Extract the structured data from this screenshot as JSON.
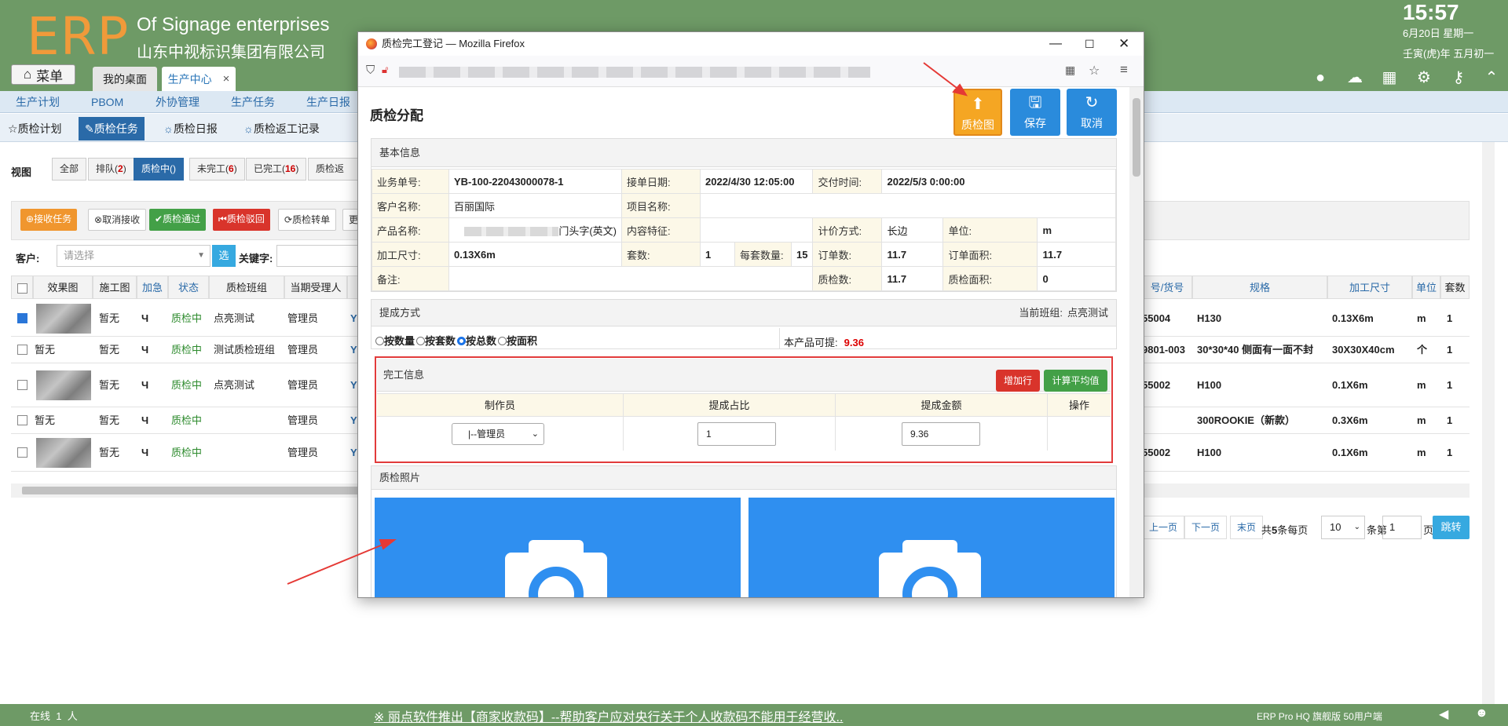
{
  "header": {
    "logo": "ERP",
    "company_en": "Of Signage enterprises",
    "company_cn": "山东中视标识集团有限公司",
    "time": "15:57",
    "date": "6月20日 星期一",
    "lunar": "壬寅(虎)年 五月初一",
    "menu_label": "菜单",
    "tabs": [
      {
        "label": "我的桌面"
      },
      {
        "label": "生产中心"
      }
    ],
    "tab_close": "×"
  },
  "nav1": [
    "生产计划",
    "PBOM",
    "外协管理",
    "生产任务",
    "生产日报"
  ],
  "nav2": [
    "质检计划",
    "质检任务",
    "质检日报",
    "质检返工记录"
  ],
  "view": {
    "label": "视图",
    "filters": [
      {
        "label": "全部",
        "count": ""
      },
      {
        "label": "排队(",
        "count": "2",
        "close": ")"
      },
      {
        "label": "质检中(",
        "count": "",
        "close": ")"
      },
      {
        "label": "未完工(",
        "count": "6",
        "close": ")"
      },
      {
        "label": "已完工(",
        "count": "16",
        "close": ")"
      },
      {
        "label": "质检返工(",
        "count": "",
        "close": ""
      }
    ]
  },
  "toolbar": {
    "buttons": [
      "接收任务",
      "取消接收",
      "质检通过",
      "质检驳回",
      "质检转单",
      "更"
    ],
    "customer_label": "客户:",
    "customer_placeholder": "请选择",
    "pick_label": "选",
    "keyword_label": "关键字:"
  },
  "table": {
    "headers_left": [
      "效果图",
      "施工图",
      "加急",
      "状态",
      "质检班组",
      "当期受理人"
    ],
    "headers_right": [
      "号/货号",
      "规格",
      "加工尺寸",
      "单位",
      "套数"
    ],
    "rows": [
      {
        "checked": true,
        "effect": "",
        "drawing": "暂无",
        "urgent": "Ч",
        "status": "质检中",
        "team": "点亮测试",
        "handler": "管理员",
        "col_y": "Y",
        "code": "55004",
        "spec": "H130",
        "size": "0.13X6m",
        "unit": "m",
        "sets": "1"
      },
      {
        "checked": false,
        "effect": "暂无",
        "drawing": "暂无",
        "urgent": "Ч",
        "status": "质检中",
        "team": "测试质检班组",
        "handler": "管理员",
        "col_y": "Y",
        "code": "9801-003",
        "spec": "30*30*40 侧面有一面不封",
        "size": "30X30X40cm",
        "unit": "个",
        "sets": "1"
      },
      {
        "checked": false,
        "effect": "",
        "drawing": "暂无",
        "urgent": "Ч",
        "status": "质检中",
        "team": "点亮测试",
        "handler": "管理员",
        "col_y": "Y",
        "code": "55002",
        "spec": "H100",
        "size": "0.1X6m",
        "unit": "m",
        "sets": "1"
      },
      {
        "checked": false,
        "effect": "暂无",
        "drawing": "暂无",
        "urgent": "Ч",
        "status": "质检中",
        "team": "",
        "handler": "管理员",
        "col_y": "Y",
        "code": "",
        "spec": "300ROOKIE（新款）",
        "size": "0.3X6m",
        "unit": "m",
        "sets": "1"
      },
      {
        "checked": false,
        "effect": "",
        "drawing": "暂无",
        "urgent": "Ч",
        "status": "质检中",
        "team": "",
        "handler": "管理员",
        "col_y": "Y",
        "code": "55002",
        "spec": "H100",
        "size": "0.1X6m",
        "unit": "m",
        "sets": "1"
      }
    ]
  },
  "pager": {
    "prev": "上一页",
    "next": "下一页",
    "last": "末页",
    "total_prefix": "共",
    "total": "5",
    "total_suffix": "条每页",
    "per_page": "10",
    "goto_prefix": "条第",
    "page": "1",
    "goto_suffix": "页",
    "jump": "跳转"
  },
  "footer": {
    "online_label": "在线",
    "online_count": "1",
    "online_unit": "人",
    "marquee": "※ 丽点软件推出【商家收款码】--帮助客户应对央行关于个人收款码不能用于经营收..",
    "version": "ERP Pro HQ 旗舰版 50用户端"
  },
  "popup": {
    "window_title": "质检完工登记 — Mozilla Firefox",
    "page_title": "质检分配",
    "btn_qc_image": "质检图",
    "btn_save": "保存",
    "btn_cancel": "取消",
    "basic_info_title": "基本信息",
    "basic": {
      "order_no_label": "业务单号:",
      "order_no": "YB-100-22043000078-1",
      "receive_date_label": "接单日期:",
      "receive_date": "2022/4/30 12:05:00",
      "delivery_label": "交付时间:",
      "delivery": "2022/5/3 0:00:00",
      "customer_label": "客户名称:",
      "customer": "百丽国际",
      "project_label": "项目名称:",
      "project": "",
      "product_label": "产品名称:",
      "product": "门头字(英文)",
      "content_label": "内容特征:",
      "content": "",
      "pricing_label": "计价方式:",
      "pricing": "长边",
      "unit_label": "单位:",
      "unit": "m",
      "size_label": "加工尺寸:",
      "size": "0.13X6m",
      "sets_label": "套数:",
      "sets": "1",
      "per_set_label": "每套数量:",
      "per_set": "15",
      "order_qty_label": "订单数:",
      "order_qty": "11.7",
      "order_area_label": "订单面积:",
      "order_area": "11.7",
      "remark_label": "备注:",
      "remark": "",
      "qc_qty_label": "质检数:",
      "qc_qty": "11.7",
      "qc_area_label": "质检面积:",
      "qc_area": "0"
    },
    "commission_title": "提成方式",
    "current_team_label": "当前班组:",
    "current_team": "点亮测试",
    "commission_options": [
      "按数量",
      "按套数",
      "按总数",
      "按面积"
    ],
    "commission_selected": "按总数",
    "commission_available_label": "本产品可提:",
    "commission_available": "9.36",
    "completion_title": "完工信息",
    "btn_add_row": "增加行",
    "btn_avg": "计算平均值",
    "completion_headers": [
      "制作员",
      "提成占比",
      "提成金额",
      "操作"
    ],
    "completion_row": {
      "maker": "|--管理员",
      "ratio": "1",
      "amount": "9.36"
    },
    "photos_title": "质检照片"
  },
  "colors": {
    "header_green": "#6e9a66",
    "accent_blue": "#2a6aa8",
    "orange": "#f5a623",
    "red": "#d9342b",
    "green": "#43a047",
    "photo_blue": "#2f8ff0"
  }
}
